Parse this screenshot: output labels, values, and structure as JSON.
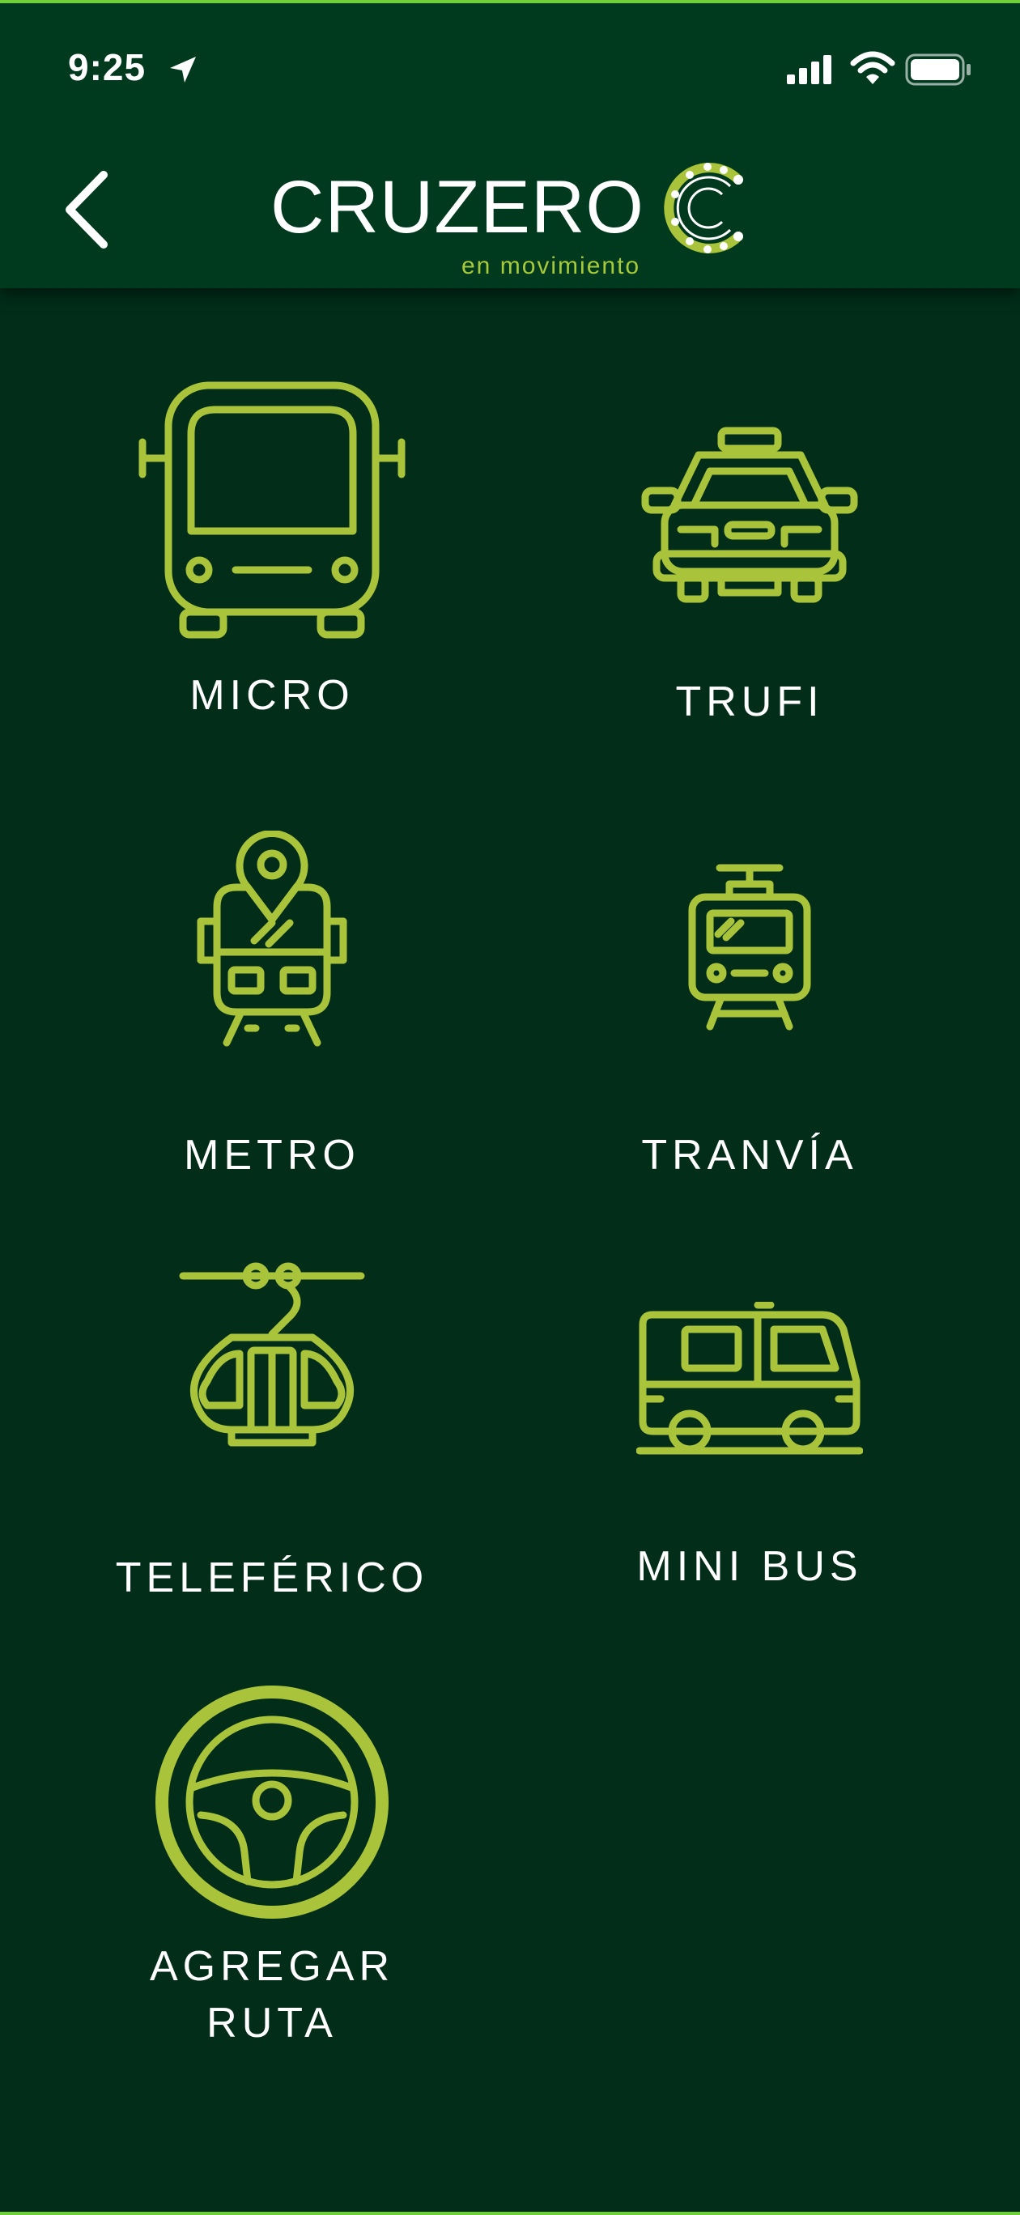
{
  "status_bar": {
    "time": "9:25",
    "icons": [
      "location-arrow-icon",
      "signal-icon",
      "wifi-icon",
      "battery-icon"
    ]
  },
  "header": {
    "back_icon": "chevron-left-icon",
    "logo_text": "CRUZERO",
    "logo_subtitle": "en movimiento"
  },
  "colors": {
    "background": "#012d19",
    "header": "#003a1e",
    "accent": "#a9c43a",
    "text": "#ffffff",
    "border": "#6fcf3a"
  },
  "transport_options": [
    {
      "label": "MICRO",
      "icon": "bus-icon"
    },
    {
      "label": "TRUFI",
      "icon": "taxi-icon"
    },
    {
      "label": "METRO",
      "icon": "metro-train-icon"
    },
    {
      "label": "TRANVÍA",
      "icon": "tram-icon"
    },
    {
      "label": "TELEFÉRICO",
      "icon": "cable-car-icon"
    },
    {
      "label": "MINI BUS",
      "icon": "minibus-icon"
    },
    {
      "label": "AGREGAR\nRUTA",
      "icon": "steering-wheel-icon"
    }
  ]
}
